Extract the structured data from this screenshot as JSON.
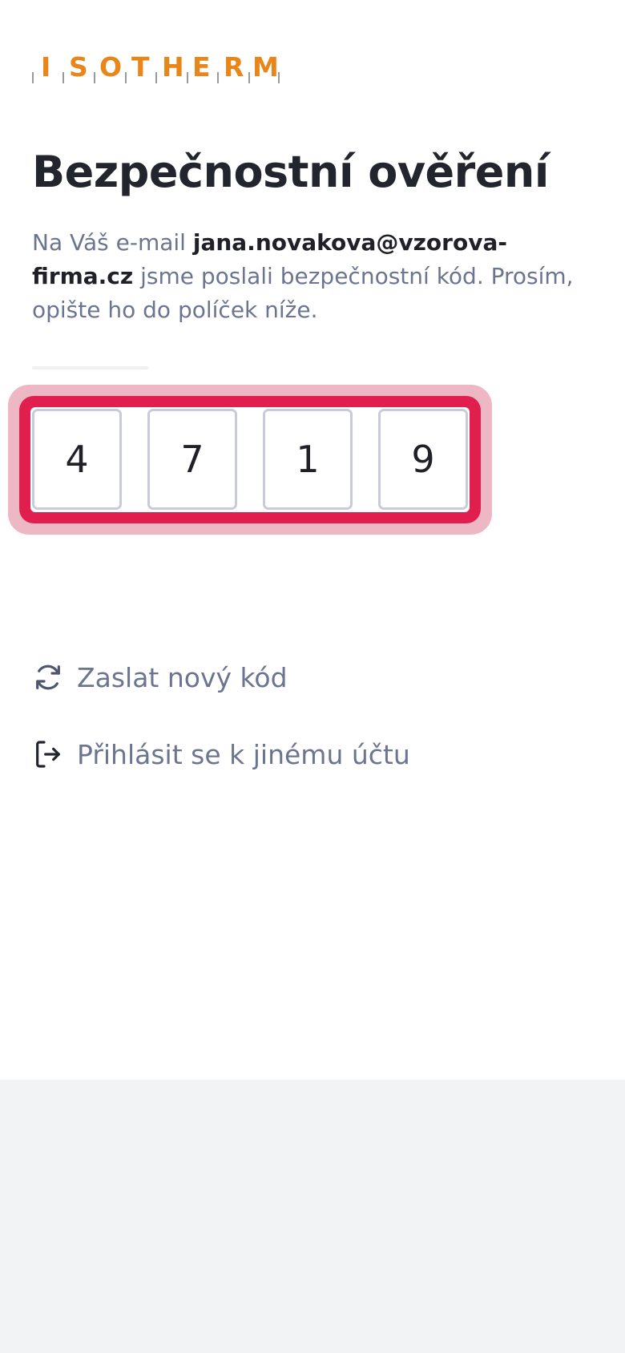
{
  "brand": {
    "logo_text": "ISOTHERM",
    "color": "#e8861a"
  },
  "header": {
    "title": "Bezpečnostní ověření"
  },
  "message": {
    "prefix": "Na Váš e-mail ",
    "email": "jana.novakova@vzorova-firma.cz",
    "suffix": " jsme poslali bezpečnostní kód. Prosím, opište ho do políček níže."
  },
  "code": {
    "digits": [
      "4",
      "7",
      "1",
      "9"
    ],
    "error_color": "#e01f4f"
  },
  "actions": {
    "resend_label": "Zaslat nový kód",
    "resend_icon": "refresh-icon",
    "switch_account_label": "Přihlásit se k jinému účtu",
    "switch_account_icon": "logout-icon"
  }
}
